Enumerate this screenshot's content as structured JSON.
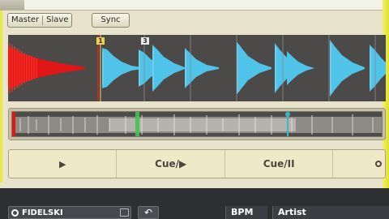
{
  "deck": {
    "master_label": "Master",
    "slave_label": "Slave",
    "sync_label": "Sync",
    "play_icon": "play-icon",
    "cue_play_label": "Cue/▶",
    "cue_pause_label": "Cue/II",
    "cue_markers": [
      "1",
      "3"
    ]
  },
  "browser": {
    "search_value": "FIDELSKI",
    "undo_icon": "undo-icon",
    "columns": [
      "BPM",
      "Artist"
    ]
  },
  "colors": {
    "waveform_played": "#e01515",
    "waveform_upcoming": "#4fc3e8",
    "panel_accent": "#e9ea40",
    "cue_marker_1": "#f0d050",
    "cue_marker_2": "#e8e8e8",
    "overview_cue_green": "#43c24f",
    "overview_cue_cyan": "#39b6c8"
  }
}
